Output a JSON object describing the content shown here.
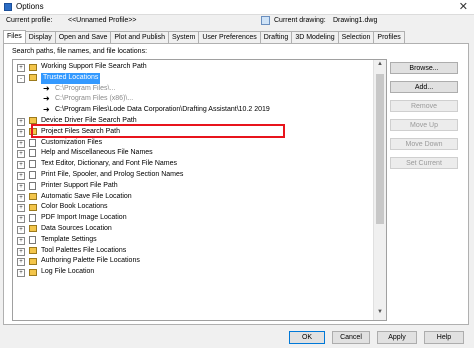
{
  "window": {
    "title": "Options",
    "close_glyph": "✕"
  },
  "profile": {
    "current_profile_label": "Current profile:",
    "current_profile_value": "<<Unnamed Profile>>",
    "current_drawing_label": "Current drawing:",
    "current_drawing_value": "Drawing1.dwg"
  },
  "tabs": [
    "Files",
    "Display",
    "Open and Save",
    "Plot and Publish",
    "System",
    "User Preferences",
    "Drafting",
    "3D Modeling",
    "Selection",
    "Profiles"
  ],
  "panel": {
    "label": "Search paths, file names, and file locations:"
  },
  "tree": [
    {
      "label": "Working Support File Search Path",
      "expander": "+",
      "icon": "folder-icon"
    },
    {
      "label": "Trusted Locations",
      "expander": "-",
      "icon": "folder-icon",
      "selected": true
    },
    {
      "label": "C:\\Program Files\\...",
      "child": true,
      "gray": true
    },
    {
      "label": "C:\\Program Files (x86)\\...",
      "child": true,
      "gray": true
    },
    {
      "label": "C:\\Program Files\\Lode Data Corporation\\Drafting Assistant\\10.2 2019",
      "child": true
    },
    {
      "label": "Device Driver File Search Path",
      "expander": "+",
      "icon": "folder-icon"
    },
    {
      "label": "Project Files Search Path",
      "expander": "+",
      "icon": "folder-icon"
    },
    {
      "label": "Customization Files",
      "expander": "+",
      "icon": "document-icon"
    },
    {
      "label": "Help and Miscellaneous File Names",
      "expander": "+",
      "icon": "document-icon"
    },
    {
      "label": "Text Editor, Dictionary, and Font File Names",
      "expander": "+",
      "icon": "document-icon"
    },
    {
      "label": "Print File, Spooler, and Prolog Section Names",
      "expander": "+",
      "icon": "document-icon"
    },
    {
      "label": "Printer Support File Path",
      "expander": "+",
      "icon": "document-icon"
    },
    {
      "label": "Automatic Save File Location",
      "expander": "+",
      "icon": "folder-icon"
    },
    {
      "label": "Color Book Locations",
      "expander": "+",
      "icon": "folder-icon"
    },
    {
      "label": "PDF Import Image Location",
      "expander": "+",
      "icon": "document-icon"
    },
    {
      "label": "Data Sources Location",
      "expander": "+",
      "icon": "folder-icon"
    },
    {
      "label": "Template Settings",
      "expander": "+",
      "icon": "document-icon"
    },
    {
      "label": "Tool Palettes File Locations",
      "expander": "+",
      "icon": "folder-icon"
    },
    {
      "label": "Authoring Palette File Locations",
      "expander": "+",
      "icon": "folder-icon"
    },
    {
      "label": "Log File Location",
      "expander": "+",
      "icon": "folder-icon"
    }
  ],
  "side_buttons": [
    {
      "label": "Browse...",
      "enabled": true
    },
    {
      "label": "Add...",
      "enabled": true
    },
    {
      "label": "Remove",
      "enabled": false
    },
    {
      "label": "Move Up",
      "enabled": false
    },
    {
      "label": "Move Down",
      "enabled": false
    },
    {
      "label": "Set Current",
      "enabled": false
    }
  ],
  "bottom_buttons": {
    "ok": "OK",
    "cancel": "Cancel",
    "apply": "Apply",
    "help": "Help"
  }
}
